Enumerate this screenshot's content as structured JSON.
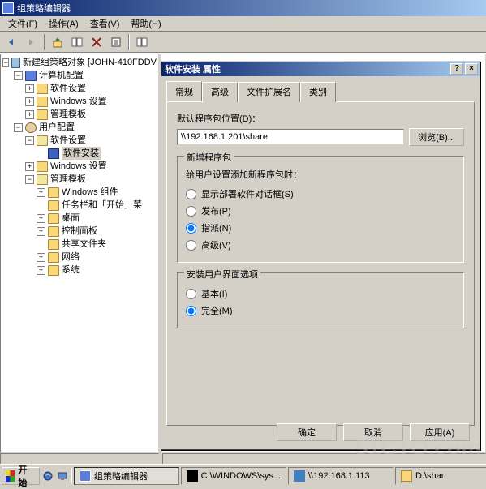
{
  "window": {
    "title": "组策略编辑器"
  },
  "menu": {
    "file": "文件(F)",
    "action": "操作(A)",
    "view": "查看(V)",
    "help": "帮助(H)"
  },
  "tree": {
    "root": "新建组策略对象 [JOHN-410FDDV",
    "computerConfig": "计算机配置",
    "softwareSettings": "软件设置",
    "windowsSettings": "Windows 设置",
    "adminTemplates": "管理模板",
    "userConfig": "用户配置",
    "softwareInstall": "软件安装",
    "windowsComponents": "Windows 组件",
    "taskbarStart": "任务栏和「开始」菜",
    "desktop": "桌面",
    "controlPanel": "控制面板",
    "sharedFolders": "共享文件夹",
    "network": "网络",
    "system": "系统"
  },
  "dialog": {
    "title": "软件安装 属性",
    "tabs": {
      "general": "常规",
      "advanced": "高级",
      "fileExt": "文件扩展名",
      "category": "类别"
    },
    "defaultPkgLabel": "默认程序包位置(D)：",
    "defaultPkgPath": "\\\\192.168.1.201\\share",
    "browseBtn": "浏览(B)...",
    "newPkgLegend": "新增程序包",
    "newPkgHint": "给用户设置添加新程序包时：",
    "opt_showDialog": "显示部署软件对话框(S)",
    "opt_publish": "发布(P)",
    "opt_assign": "指派(N)",
    "opt_advanced": "高级(V)",
    "uiLegend": "安装用户界面选项",
    "opt_basic": "基本(I)",
    "opt_full": "完全(M)",
    "ok": "确定",
    "cancel": "取消",
    "apply": "应用(A)"
  },
  "taskbar": {
    "start": "开始",
    "task1": "组策略编辑器",
    "task2": "C:\\WINDOWS\\sys...",
    "task3": "\\\\192.168.1.113",
    "task4": "D:\\shar"
  },
  "watermark": "51CTO.com"
}
